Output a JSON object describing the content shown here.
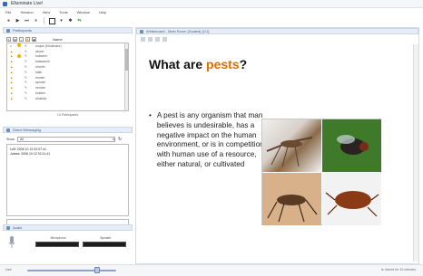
{
  "window": {
    "title": "Elluminate Live!"
  },
  "menu": [
    "File",
    "Session",
    "View",
    "Tools",
    "Window",
    "Help"
  ],
  "participants_panel": {
    "title": "Participants",
    "name_header": "Name",
    "rows": [
      "mojoin (Moderator)",
      "aborin",
      "bobbenh",
      "bdawanhh",
      "ohnrhh",
      "fulkb",
      "moneh",
      "aponsh",
      "neoolm",
      "boldmn",
      "ichabda"
    ],
    "count": "15 Participants"
  },
  "messaging_panel": {
    "title": "Direct Messaging",
    "show_label": "Show",
    "show_value": "All",
    "messages": [
      "Left: 2006 10 12 02:07:41",
      "Joined: 2006 10 12 02:11:41"
    ]
  },
  "audio_panel": {
    "title": "Audio",
    "mic_label": "Microphone",
    "speaker_label": "Speaker"
  },
  "bottom_bar": {
    "slider_label": "Live",
    "status": "Is Joined for 10 minutes"
  },
  "whiteboard": {
    "title": "Whiteboard - Main Room (Scaled) [1/1]"
  },
  "slide": {
    "heading_prefix": "What are ",
    "heading_accent": "pests",
    "heading_suffix": "?",
    "bullet_text": "A pest is any organism that man believes is undesirable, has a negative impact on the human environment, or is in competition with human use of a resource, either natural, or cultivated"
  },
  "colors": {
    "heading_accent": "#e06c00",
    "panel_head": "#e6edf6",
    "meter": "#1d1d1d"
  }
}
